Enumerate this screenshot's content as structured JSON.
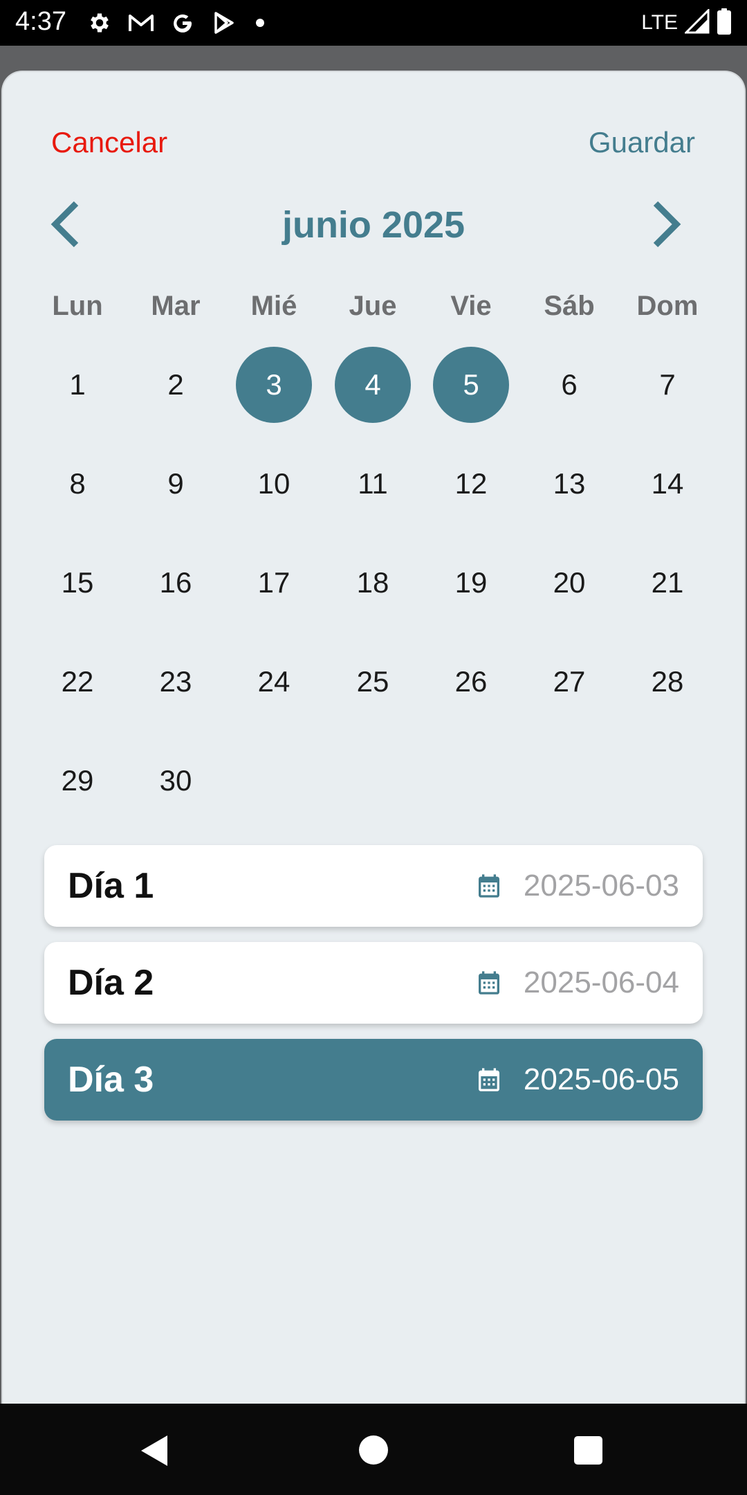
{
  "status_bar": {
    "time": "4:37",
    "icons": [
      "gear-icon",
      "gmail-icon",
      "google-icon",
      "play-store-icon",
      "notification-dot-icon"
    ],
    "network": "LTE",
    "right_icons": [
      "signal-icon",
      "battery-icon"
    ]
  },
  "header": {
    "cancel_label": "Cancelar",
    "save_label": "Guardar",
    "cancel_color": "#e8190e",
    "accent_color": "#447d8e"
  },
  "calendar": {
    "month_title": "junio 2025",
    "weekdays": [
      "Lun",
      "Mar",
      "Mié",
      "Jue",
      "Vie",
      "Sáb",
      "Dom"
    ],
    "days": [
      "1",
      "2",
      "3",
      "4",
      "5",
      "6",
      "7",
      "8",
      "9",
      "10",
      "11",
      "12",
      "13",
      "14",
      "15",
      "16",
      "17",
      "18",
      "19",
      "20",
      "21",
      "22",
      "23",
      "24",
      "25",
      "26",
      "27",
      "28",
      "29",
      "30"
    ],
    "first_weekday_index": 0,
    "selected_days": [
      "3",
      "4",
      "5"
    ]
  },
  "selected_list": [
    {
      "label": "Día 1",
      "date": "2025-06-03",
      "active": false
    },
    {
      "label": "Día 2",
      "date": "2025-06-04",
      "active": false
    },
    {
      "label": "Día 3",
      "date": "2025-06-05",
      "active": true
    }
  ],
  "nav_bar": {
    "icons": [
      "back-icon",
      "home-icon",
      "recents-icon"
    ]
  }
}
